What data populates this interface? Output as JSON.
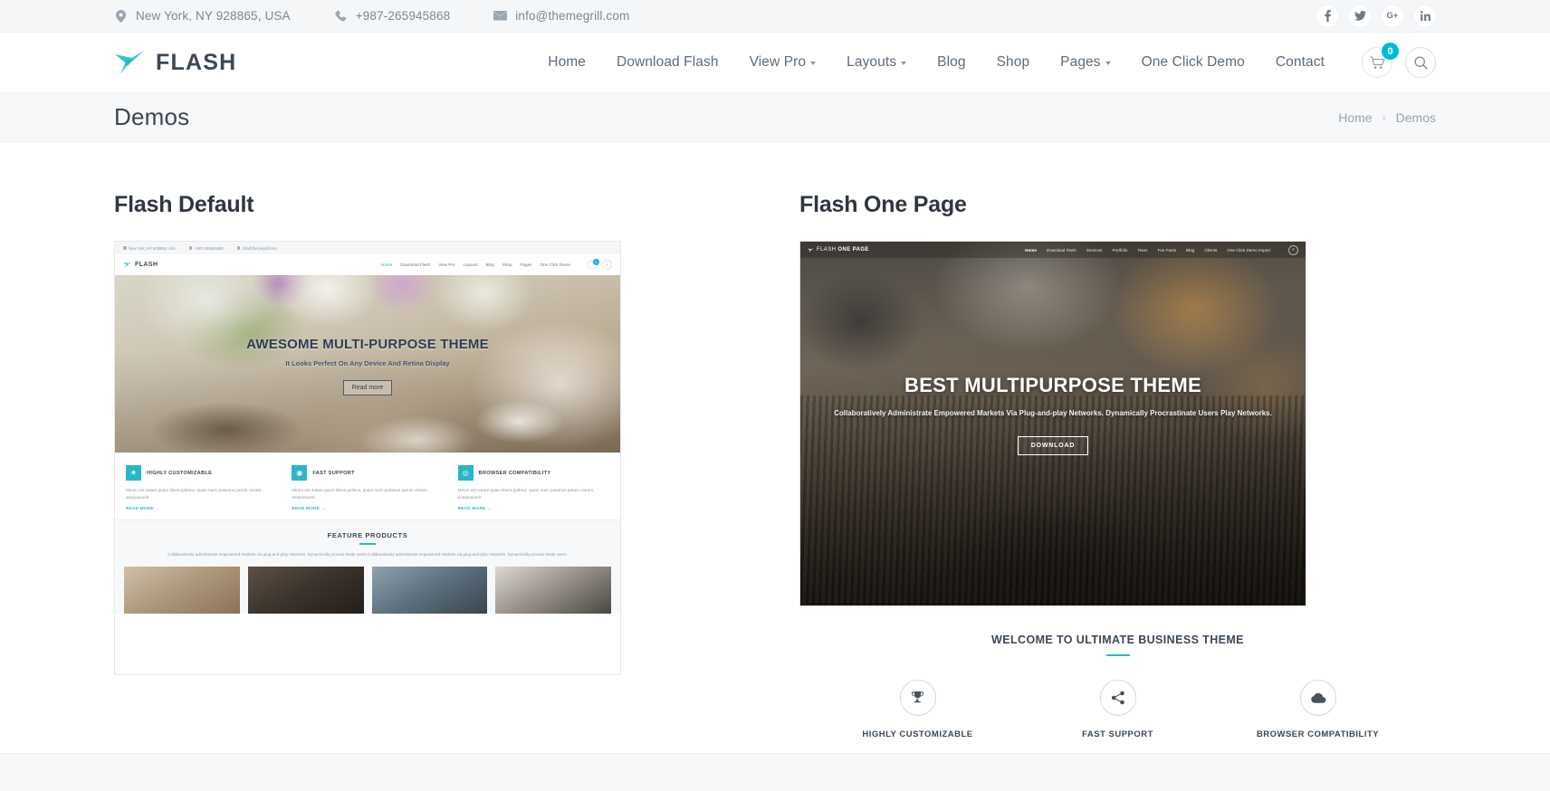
{
  "topbar": {
    "address": "New York, NY 928865, USA",
    "phone": "+987-265945868",
    "email": "info@themegrill.com",
    "social": [
      {
        "name": "facebook",
        "glyph": "f"
      },
      {
        "name": "twitter",
        "glyph": "t"
      },
      {
        "name": "google-plus",
        "glyph": "G+"
      },
      {
        "name": "linkedin",
        "glyph": "in"
      }
    ]
  },
  "header": {
    "logo_text": "FLASH",
    "nav": [
      {
        "label": "Home",
        "has_dropdown": false
      },
      {
        "label": "Download Flash",
        "has_dropdown": false
      },
      {
        "label": "View Pro",
        "has_dropdown": true
      },
      {
        "label": "Layouts",
        "has_dropdown": true
      },
      {
        "label": "Blog",
        "has_dropdown": false
      },
      {
        "label": "Shop",
        "has_dropdown": false
      },
      {
        "label": "Pages",
        "has_dropdown": true
      },
      {
        "label": "One Click Demo",
        "has_dropdown": false
      },
      {
        "label": "Contact",
        "has_dropdown": false
      }
    ],
    "cart_count": "0",
    "accent_color": "#00b9d7"
  },
  "pagebar": {
    "title": "Demos",
    "breadcrumb_home": "Home",
    "breadcrumb_sep": "›",
    "breadcrumb_current": "Demos"
  },
  "demos": [
    {
      "heading": "Flash Default",
      "preview": {
        "topbar": {
          "address": "New York, NY 928865, USA",
          "phone": "+987-265945868",
          "email": "info@themegrill.com"
        },
        "logo_text": "FLASH",
        "nav": [
          "Home",
          "Download Flash",
          "View Pro",
          "Layouts",
          "Blog",
          "Shop",
          "Pages",
          "One Click Demo"
        ],
        "cart_count": "0",
        "hero_title": "AWESOME MULTI-PURPOSE THEME",
        "hero_sub": "It Looks Perfect On Any Device And Retina Display",
        "hero_button": "Read more",
        "features": [
          {
            "icon": "gear-icon",
            "title": "HIGHLY CUSTOMIZABLE",
            "body": "Mirum est notare quam littera gothica, quam nunc putamus parum claram, anteposuerit",
            "link": "READ MORE  →"
          },
          {
            "icon": "lifebuoy-icon",
            "title": "FAST SUPPORT",
            "body": "Mirum est notare quam littera gothica, quam nunc putamus parum claram, anteposuerit",
            "link": "READ MORE  →"
          },
          {
            "icon": "browser-icon",
            "title": "BROWSER COMPATIBILITY",
            "body": "Mirum est notare quam littera gothica, quam nunc putamus parum claram, anteposuerit",
            "link": "READ MORE  →"
          }
        ],
        "products_title": "FEATURE PRODUCTS",
        "products_desc": "Collaboratively administrate empowered markets via plug-and-play networks. Dynamically procras tinate users.Collaboratively administrate empowered markets via plug-and-play networks. Dynamically procras tinate users."
      }
    },
    {
      "heading": "Flash One Page",
      "preview": {
        "logo_text_light": "FLASH ",
        "logo_text_bold": "ONE PAGE",
        "nav": [
          "Home",
          "Download Flash",
          "Services",
          "Portfolio",
          "Team",
          "Fun Facts",
          "Blog",
          "Clients",
          "One Click Demo Import"
        ],
        "hero_title": "BEST MULTIPURPOSE THEME",
        "hero_sub": "Collaboratively Administrate Empowered Markets Via Plug-and-play Networks. Dynamically Procrastinate Users Play Networks.",
        "hero_button": "DOWNLOAD",
        "welcome_title": "WELCOME TO ULTIMATE BUSINESS THEME",
        "icon_items": [
          {
            "icon": "trophy-icon",
            "label": "HIGHLY CUSTOMIZABLE",
            "glyph": "⚇"
          },
          {
            "icon": "share-icon",
            "label": "FAST SUPPORT",
            "glyph": "⚭"
          },
          {
            "icon": "cloud-icon",
            "label": "BROWSER COMPATIBILITY",
            "glyph": "☁"
          }
        ]
      }
    }
  ]
}
